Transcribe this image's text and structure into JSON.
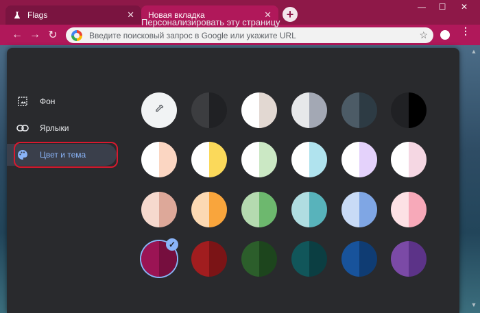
{
  "window": {
    "tabs": [
      {
        "title": "Flags",
        "icon": "flask-icon"
      },
      {
        "title": "Новая вкладка"
      }
    ],
    "controls": {
      "minimize": "—",
      "maximize": "☐",
      "close": "✕"
    }
  },
  "toolbar": {
    "omnibox_placeholder": "Введите поисковый запрос в Google или укажите URL"
  },
  "dialog": {
    "title": "Персонализировать эту страницу",
    "sidebar": [
      {
        "label": "Фон",
        "icon": "image-icon"
      },
      {
        "label": "Ярлыки",
        "icon": "link-icon"
      },
      {
        "label": "Цвет и тема",
        "icon": "palette-icon",
        "selected": true
      }
    ],
    "swatches": [
      [
        {
          "picker": true
        },
        {
          "left": "#3c3d40",
          "right": "#202124"
        },
        {
          "left": "#ffffff",
          "right": "#e2d8d2"
        },
        {
          "left": "#e7e8ea",
          "right": "#a3a8b4"
        },
        {
          "left": "#4c5b66",
          "right": "#2d3b44"
        },
        {
          "left": "#202124",
          "right": "#000000"
        }
      ],
      [
        {
          "left": "#ffffff",
          "right": "#fbd6c2"
        },
        {
          "left": "#ffffff",
          "right": "#fbd95a"
        },
        {
          "left": "#ffffff",
          "right": "#cbe8c4"
        },
        {
          "left": "#ffffff",
          "right": "#b0e3ee"
        },
        {
          "left": "#ffffff",
          "right": "#e4d2fb"
        },
        {
          "left": "#ffffff",
          "right": "#f5d7e3"
        }
      ],
      [
        {
          "left": "#f6d9ce",
          "right": "#dda899"
        },
        {
          "left": "#fcd9b3",
          "right": "#f9a53c"
        },
        {
          "left": "#b5dab0",
          "right": "#6db86e"
        },
        {
          "left": "#b0dde1",
          "right": "#58b3bb"
        },
        {
          "left": "#c9dbf6",
          "right": "#7fa6e4"
        },
        {
          "left": "#fde1e5",
          "right": "#f7a9b9"
        }
      ],
      [
        {
          "left": "#9b1454",
          "right": "#760e3e",
          "selected": true
        },
        {
          "left": "#a11d1f",
          "right": "#7b1416"
        },
        {
          "left": "#2c5e2b",
          "right": "#1d451d"
        },
        {
          "left": "#11565a",
          "right": "#0b3e42"
        },
        {
          "left": "#18539b",
          "right": "#0f3c73"
        },
        {
          "left": "#7b4aa6",
          "right": "#5c3388"
        }
      ]
    ]
  },
  "colors": {
    "accent": "#8ab4f8",
    "highlight_ring": "#d7192f",
    "chrome": "#8e1848",
    "dialog_bg": "#292a2d"
  }
}
